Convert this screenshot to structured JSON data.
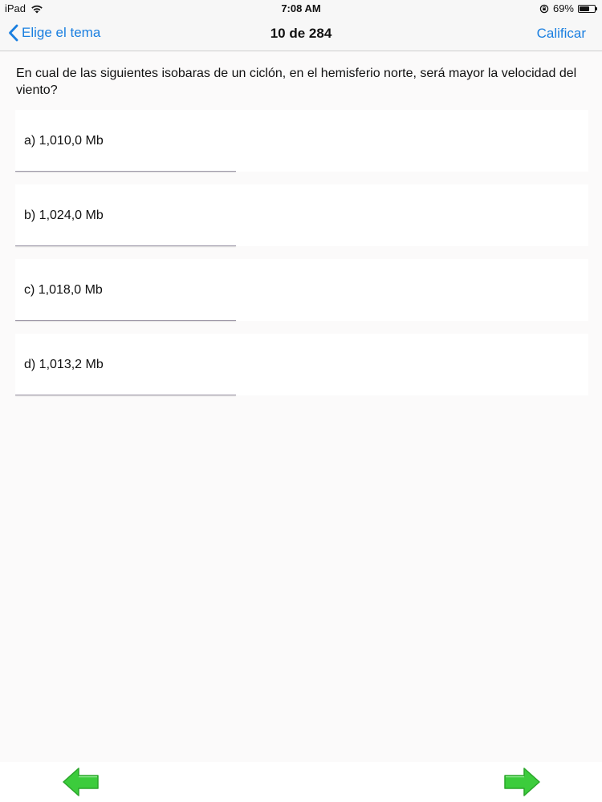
{
  "status_bar": {
    "device": "iPad",
    "time": "7:08 AM",
    "battery_percent": "69%",
    "battery_level": 0.69
  },
  "nav": {
    "back_label": "Elige el tema",
    "title": "10 de 284",
    "action_label": "Calificar"
  },
  "question": {
    "text": "En cual de las siguientes isobaras de un ciclón, en el hemisferio norte, será mayor la velocidad del viento?"
  },
  "options": [
    {
      "label": "a) 1,010,0 Mb"
    },
    {
      "label": "b) 1,024,0 Mb"
    },
    {
      "label": "c) 1,018,0 Mb"
    },
    {
      "label": "d) 1,013,2 Mb"
    }
  ],
  "icons": {
    "prev": "arrow-left-icon",
    "next": "arrow-right-icon"
  },
  "colors": {
    "accent": "#1a7fe0",
    "arrow": "#3ccc3c",
    "arrow_dark": "#2aa52a"
  }
}
